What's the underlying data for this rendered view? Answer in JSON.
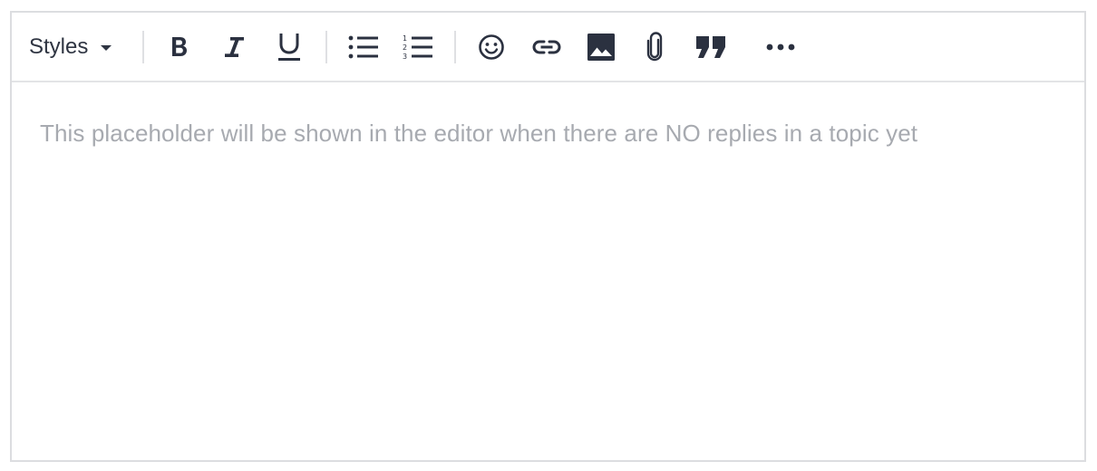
{
  "toolbar": {
    "styles_label": "Styles",
    "icons": {
      "bold": "bold-icon",
      "italic": "italic-icon",
      "underline": "underline-icon",
      "bullet_list": "bullet-list-icon",
      "numbered_list": "numbered-list-icon",
      "emoji": "emoji-icon",
      "link": "link-icon",
      "image": "image-icon",
      "attachment": "paperclip-icon",
      "quote": "quote-icon",
      "more": "more-icon"
    }
  },
  "editor": {
    "placeholder": "This placeholder will be shown in the editor when there are NO replies in a topic yet"
  },
  "colors": {
    "icon": "#2b3140",
    "placeholder": "#a7aab0",
    "border": "#dcdde0"
  }
}
